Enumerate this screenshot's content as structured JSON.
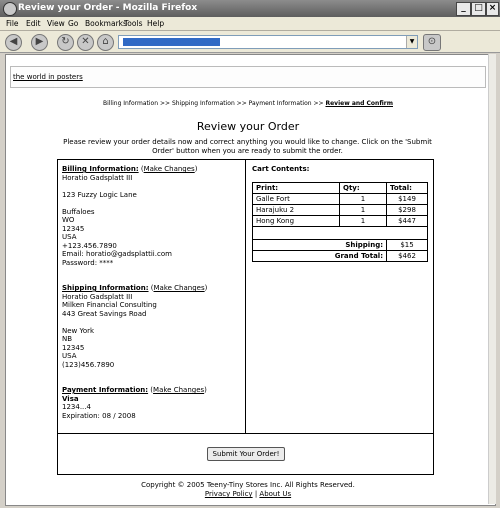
{
  "window": {
    "title": "Review your Order - Mozilla Firefox"
  },
  "menu": [
    "File",
    "Edit",
    "View",
    "Go",
    "Bookmarks",
    "Tools",
    "Help"
  ],
  "toolbar": {
    "address": "http://shop/orderreview.php"
  },
  "site": {
    "banner_link": "the world in posters"
  },
  "breadcrumb": {
    "step1": "Billing Information",
    "step2": "Shipping Information",
    "step3": "Payment Information",
    "step4": "Review and Confirm",
    "sep": ">>"
  },
  "page": {
    "title": "Review your Order",
    "intro": "Please review your order details now and correct anything you would like to change. Click on the 'Submit Order' button when you are ready to submit the order."
  },
  "billing": {
    "heading": "Billing Information:",
    "change": "Make Changes",
    "name": "Horatio Gadsplatt III",
    "address": "123 Fuzzy Logic Lane",
    "city": "Buffaloes",
    "state": "WO",
    "zip": "12345",
    "country": "USA",
    "phone": "+123.456.7890",
    "email": "Email: horatio@gadsplattii.com",
    "password": "Password: ****"
  },
  "shipping": {
    "heading": "Shipping Information:",
    "change": "Make Changes",
    "name": "Horatio Gadsplatt III",
    "company": "Milken Financial Consulting",
    "address": "443 Great Savings Road",
    "city": "New York",
    "state": "NB",
    "zip": "12345",
    "country": "USA",
    "phone": "(123)456.7890"
  },
  "payment": {
    "heading": "Payment Information:",
    "change": "Make Changes",
    "card": "Visa",
    "number": "1234...4",
    "expiry": "Expiration: 08 / 2008"
  },
  "cart": {
    "heading": "Cart Contents:",
    "columns": [
      "Print:",
      "Qty:",
      "Total:"
    ],
    "items": [
      {
        "print": "Galle Fort",
        "qty": "1",
        "total": "$149"
      },
      {
        "print": "Harajuku 2",
        "qty": "1",
        "total": "$298"
      },
      {
        "print": "Hong Kong",
        "qty": "1",
        "total": "$447"
      }
    ],
    "shipping_label": "Shipping:",
    "shipping_value": "$15",
    "grand_label": "Grand Total:",
    "grand_value": "$462"
  },
  "submit_label": "Submit Your Order!",
  "footer": {
    "copyright": "Copyright © 2005 Teeny-Tiny Stores Inc. All Rights Reserved.",
    "privacy": "Privacy Policy",
    "sep": "|",
    "about": "About Us"
  }
}
